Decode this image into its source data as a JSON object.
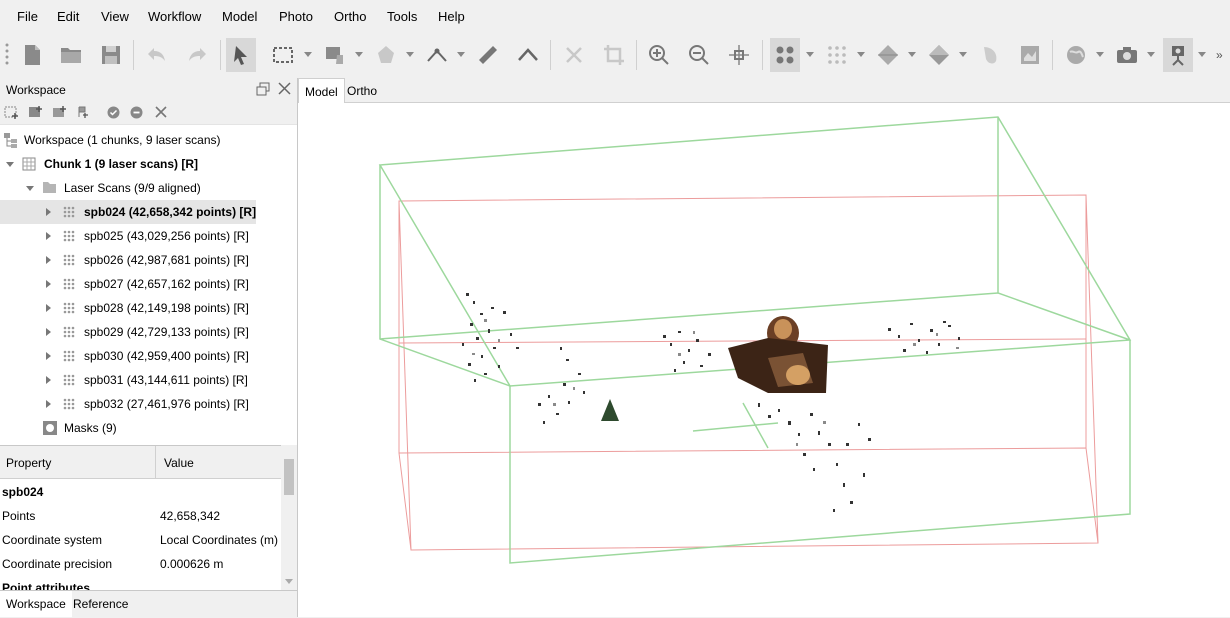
{
  "menu": [
    {
      "label": "File",
      "name": "menu-file"
    },
    {
      "label": "Edit",
      "name": "menu-edit"
    },
    {
      "label": "View",
      "name": "menu-view"
    },
    {
      "label": "Workflow",
      "name": "menu-workflow"
    },
    {
      "label": "Model",
      "name": "menu-model"
    },
    {
      "label": "Photo",
      "name": "menu-photo"
    },
    {
      "label": "Ortho",
      "name": "menu-ortho"
    },
    {
      "label": "Tools",
      "name": "menu-tools"
    },
    {
      "label": "Help",
      "name": "menu-help"
    }
  ],
  "workspace": {
    "title": "Workspace",
    "root_label": "Workspace (1 chunks, 9 laser scans)",
    "chunk_label": "Chunk 1 (9 laser scans) [R]",
    "laser_scans_label": "Laser Scans (9/9 aligned)",
    "scans": [
      "spb024 (42,658,342 points) [R]",
      "spb025 (43,029,256 points) [R]",
      "spb026 (42,987,681 points) [R]",
      "spb027 (42,657,162 points) [R]",
      "spb028 (42,149,198 points) [R]",
      "spb029 (42,729,133 points) [R]",
      "spb030 (42,959,400 points) [R]",
      "spb031 (43,144,611 points) [R]",
      "spb032 (27,461,976 points) [R]"
    ],
    "masks_label": "Masks (9)"
  },
  "properties": {
    "col_property": "Property",
    "col_value": "Value",
    "section": "spb024",
    "rows": [
      {
        "key": "Points",
        "value": "42,658,342"
      },
      {
        "key": "Coordinate system",
        "value": "Local Coordinates (m)"
      },
      {
        "key": "Coordinate precision",
        "value": "0.000626 m"
      }
    ],
    "next_section": "Point attributes"
  },
  "bottom_tabs": {
    "workspace": "Workspace",
    "reference": "Reference"
  },
  "view_tabs": {
    "model": "Model",
    "ortho": "Ortho"
  },
  "toolbar_icons": [
    "new-document-icon",
    "open-folder-icon",
    "save-icon",
    "undo-icon",
    "redo-icon",
    "navigation-icon",
    "rectangle-selection-icon",
    "move-object-icon",
    "draw-polygon-icon",
    "draw-polyline-icon",
    "ruler-icon",
    "shape-icon",
    "delete-icon",
    "crop-icon",
    "zoom-in-icon",
    "zoom-out-icon",
    "reset-view-icon",
    "show-points-icon",
    "show-dense-cloud-icon",
    "show-model-icon",
    "show-textured-icon",
    "show-tiled-model-icon",
    "show-dem-icon",
    "show-orthomosaic-icon",
    "show-globe-icon",
    "show-cameras-icon",
    "show-laser-scans-icon"
  ],
  "colors": {
    "region_green": "#8fd18f",
    "region_red": "#e88a8a",
    "accent": "#d8d8d8"
  }
}
